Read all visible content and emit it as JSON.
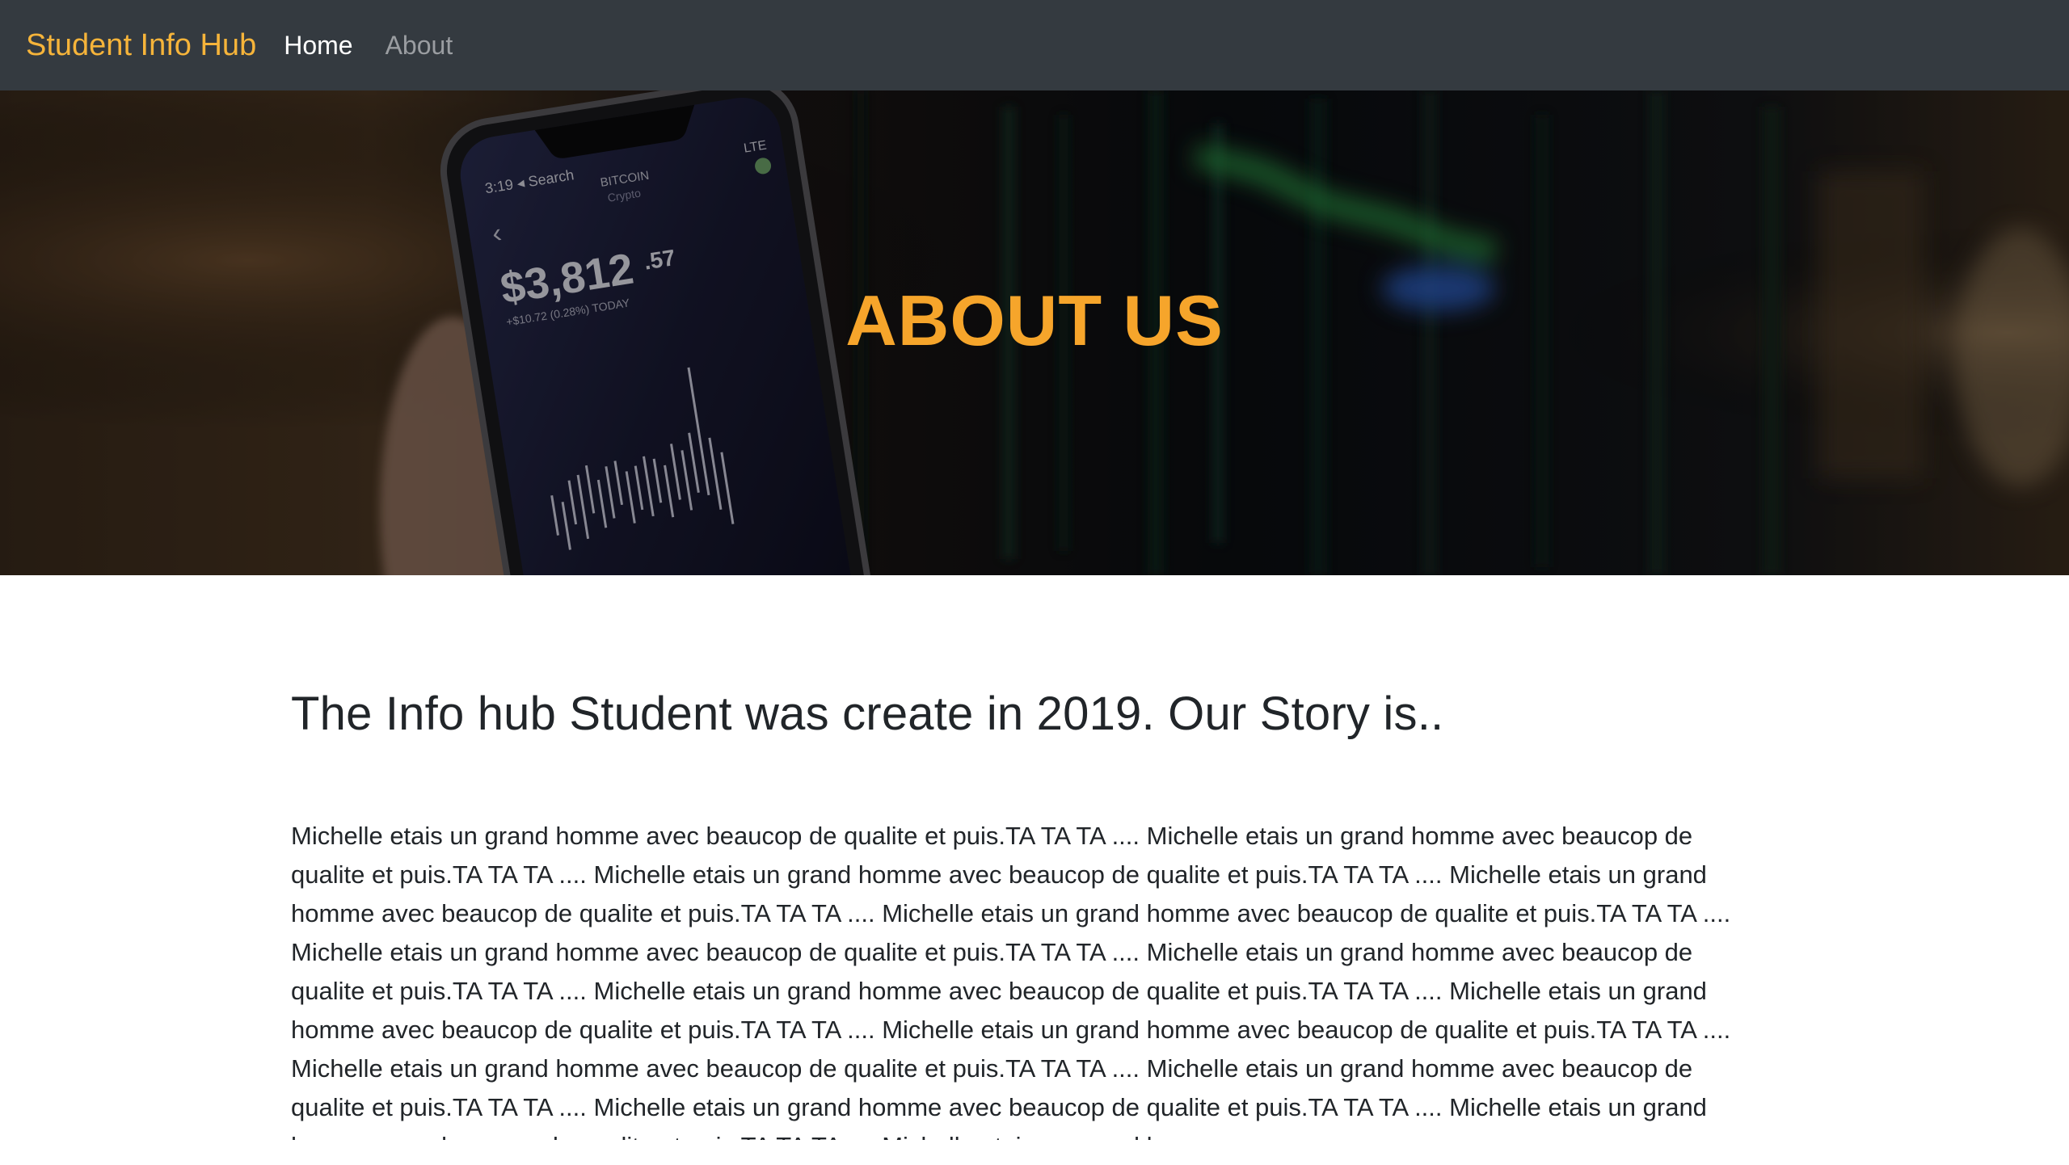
{
  "navbar": {
    "brand": "Student Info Hub",
    "links": [
      {
        "label": "Home",
        "active": true
      },
      {
        "label": "About",
        "active": false
      }
    ]
  },
  "hero": {
    "title": "ABOUT US",
    "phone_screen": {
      "time": "3:19",
      "back": "Search",
      "coin": "BITCOIN",
      "coin_sub": "Crypto",
      "price": "$3,812",
      "price_cents": ".57",
      "change": "+$10.72 (0.28%) TODAY",
      "network": "LTE"
    }
  },
  "main": {
    "heading": "The Info hub Student was create in 2019. Our Story is..",
    "body": "Michelle etais un grand homme avec beaucop de qualite et puis.TA TA TA .... Michelle etais un grand homme avec beaucop de qualite et puis.TA TA TA .... Michelle etais un grand homme avec beaucop de qualite et puis.TA TA TA .... Michelle etais un grand homme avec beaucop de qualite et puis.TA TA TA .... Michelle etais un grand homme avec beaucop de qualite et puis.TA TA TA .... Michelle etais un grand homme avec beaucop de qualite et puis.TA TA TA .... Michelle etais un grand homme avec beaucop de qualite et puis.TA TA TA .... Michelle etais un grand homme avec beaucop de qualite et puis.TA TA TA .... Michelle etais un grand homme avec beaucop de qualite et puis.TA TA TA .... Michelle etais un grand homme avec beaucop de qualite et puis.TA TA TA .... Michelle etais un grand homme avec beaucop de qualite et puis.TA TA TA .... Michelle etais un grand homme avec beaucop de qualite et puis.TA TA TA .... Michelle etais un grand homme avec beaucop de qualite et puis.TA TA TA .... Michelle etais un grand homme avec beaucop de qualite et puis.TA TA TA .... Michelle etais un grand homme avec"
  },
  "colors": {
    "navbar_bg": "#343a40",
    "brand": "#f6b43a",
    "hero_title": "#f6a52b",
    "text": "#212529"
  }
}
